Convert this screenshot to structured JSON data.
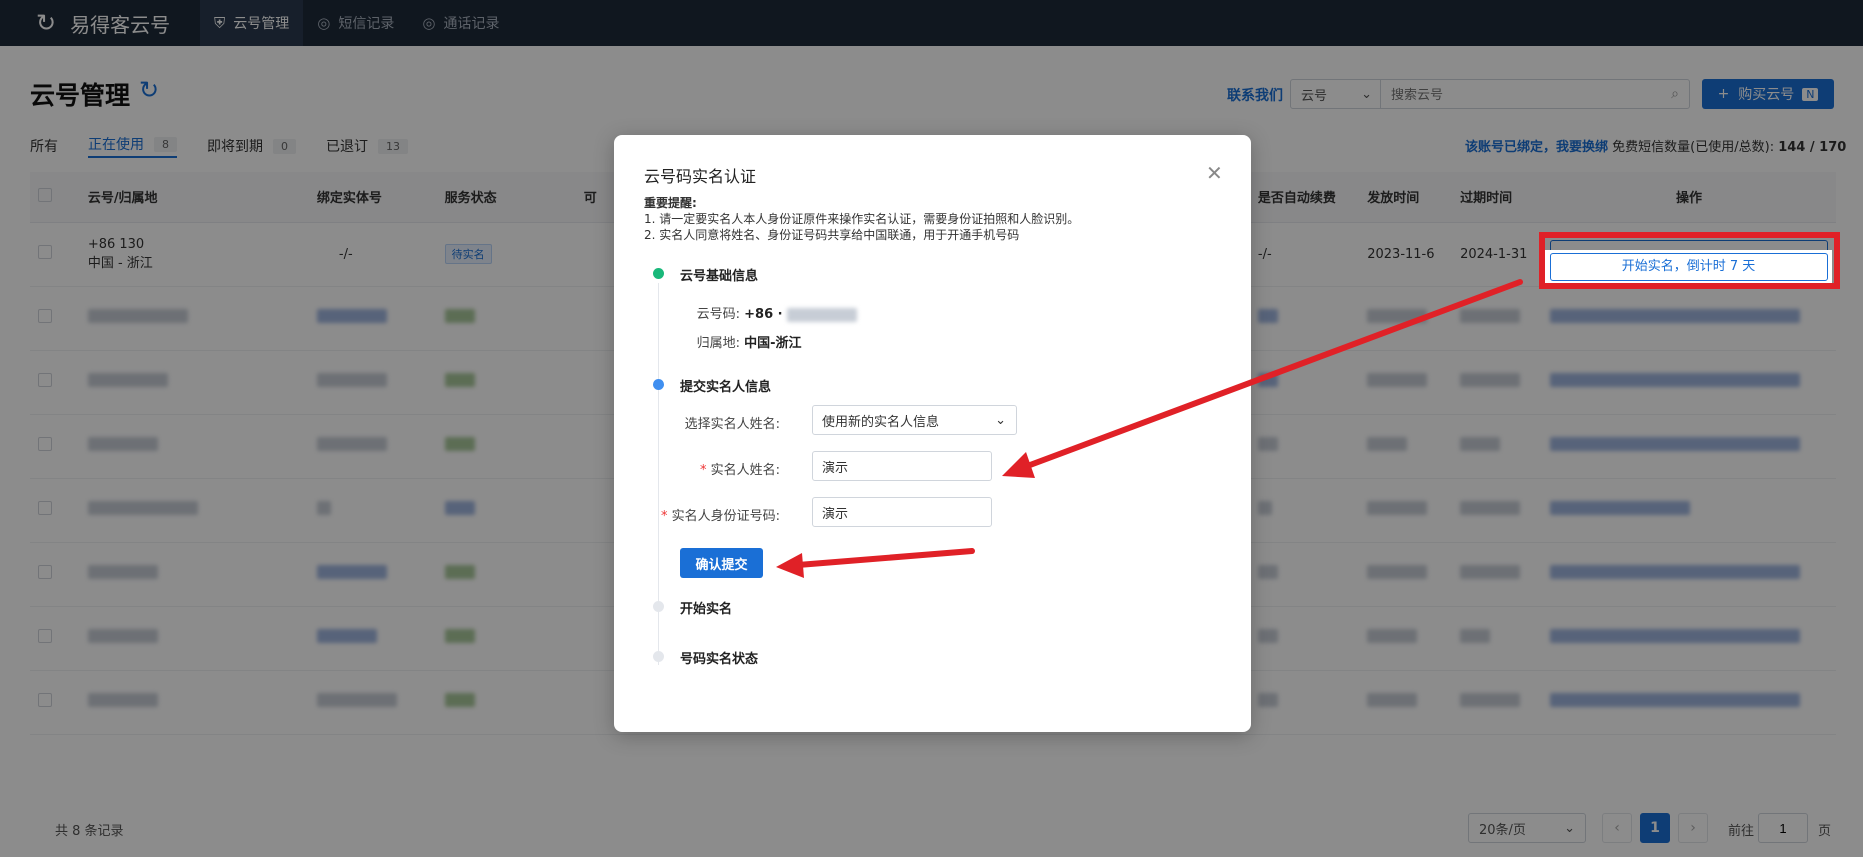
{
  "brand": {
    "name": "易得客云号"
  },
  "nav": {
    "tabs": [
      {
        "label": "云号管理",
        "icon": "shield-icon"
      },
      {
        "label": "短信记录",
        "icon": "globe-icon"
      },
      {
        "label": "通话记录",
        "icon": "globe-icon"
      }
    ]
  },
  "page": {
    "title": "云号管理",
    "contact_label": "联系我们",
    "search": {
      "select_value": "云号",
      "placeholder": "搜索云号"
    },
    "buy_button": {
      "label": "购买云号",
      "badge": "N"
    },
    "filters": [
      {
        "label": "所有",
        "count": ""
      },
      {
        "label": "正在使用",
        "count": "8"
      },
      {
        "label": "即将到期",
        "count": "0"
      },
      {
        "label": "已退订",
        "count": "13"
      }
    ],
    "bound_info": {
      "text": "该账号已绑定，",
      "link": "我要换绑",
      "sms_label": "免费短信数量(已使用/总数):",
      "sms_value": "144 / 170"
    }
  },
  "table": {
    "columns": [
      "云号/归属地",
      "绑定实体号",
      "服务状态",
      "可",
      "是否自动续费",
      "发放时间",
      "过期时间",
      "操作"
    ],
    "first_row": {
      "number": "+86 130",
      "location": "中国 - 浙江",
      "bound": "-/-",
      "status": "待实名",
      "auto_renew": "-/-",
      "issued": "2023-11-6",
      "expires": "2024-1-31",
      "action": "开始实名，倒计时 7 天"
    }
  },
  "pagination": {
    "total": "共 8 条记录",
    "page_size": "20条/页",
    "current_page": "1",
    "goto_label": "前往",
    "goto_value": "1",
    "goto_suffix": "页"
  },
  "modal": {
    "title": "云号码实名认证",
    "tips_title": "重要提醒:",
    "tip_1": "1. 请一定要实名人本人身份证原件来操作实名认证，需要身份证拍照和人脸识别。",
    "tip_2": "2. 实名人同意将姓名、身份证号码共享给中国联通，用于开通手机号码",
    "step_1": {
      "title": "云号基础信息",
      "number_label": "云号码:",
      "number_value": "+86 ·",
      "location_label": "归属地:",
      "location_value": "中国-浙江"
    },
    "step_2": {
      "title": "提交实名人信息",
      "select_label": "选择实名人姓名:",
      "select_value": "使用新的实名人信息",
      "name_label": "实名人姓名:",
      "name_value": "演示",
      "id_label": "实名人身份证号码:",
      "id_value": "演示",
      "confirm_label": "确认提交"
    },
    "step_3": {
      "title": "开始实名"
    },
    "step_4": {
      "title": "号码实名状态"
    }
  },
  "colors": {
    "primary": "#1a6fd6",
    "nav_bg": "#1e2a3a",
    "annotation_red": "#e02127",
    "step_done": "#19b87a",
    "step_current": "#3f8ff0"
  }
}
